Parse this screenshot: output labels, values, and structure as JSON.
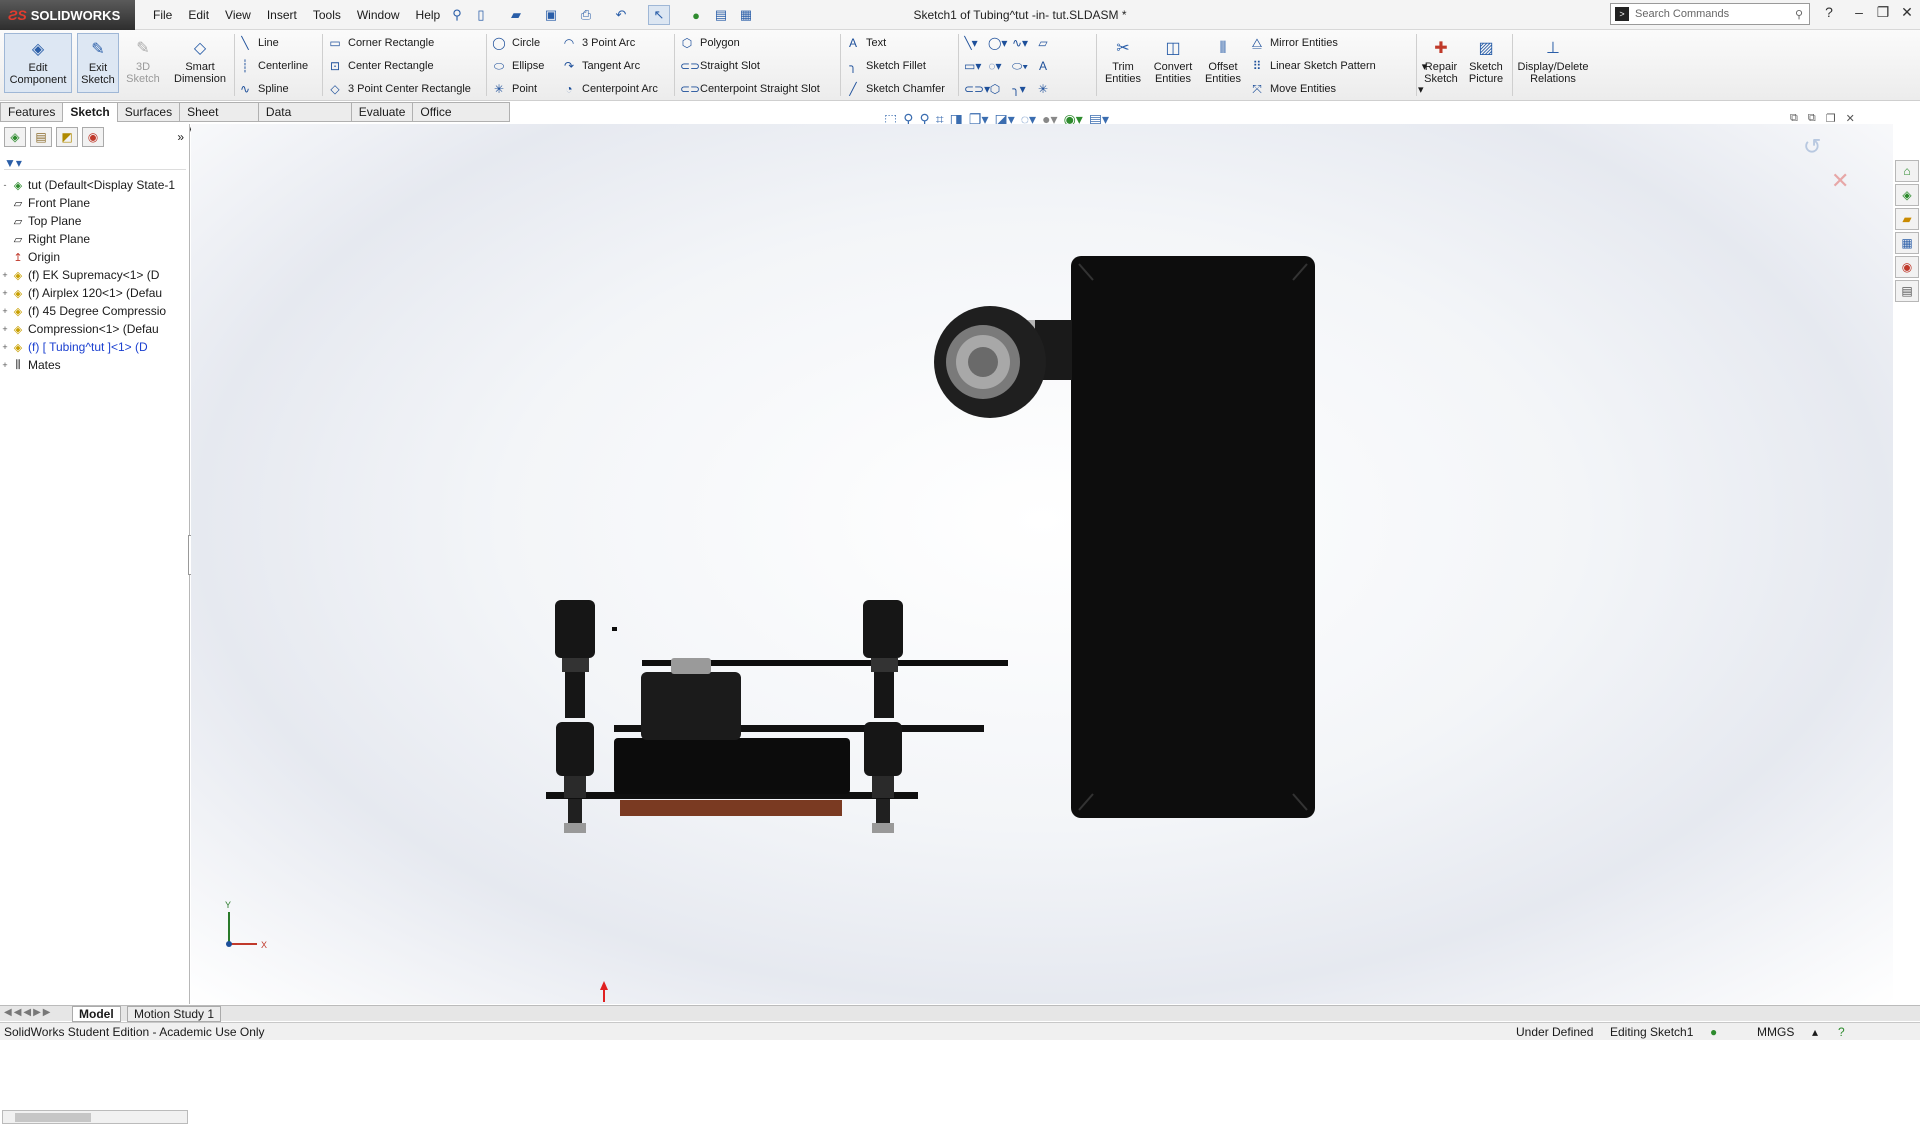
{
  "app": {
    "logo_text": "SOLIDWORKS",
    "document_title": "Sketch1 of Tubing^tut -in- tut.SLDASM *"
  },
  "menu": [
    "File",
    "Edit",
    "View",
    "Insert",
    "Tools",
    "Window",
    "Help"
  ],
  "search": {
    "placeholder": "Search Commands"
  },
  "ribbon": {
    "big_buttons": [
      {
        "label": "Edit Component",
        "icon": "edit-component-icon"
      },
      {
        "label": "Exit Sketch",
        "icon": "exit-sketch-icon"
      },
      {
        "label": "3D Sketch",
        "icon": "3d-sketch-icon"
      },
      {
        "label": "Smart Dimension",
        "icon": "smart-dimension-icon"
      }
    ],
    "col1": [
      "Line",
      "Centerline",
      "Spline"
    ],
    "col2": [
      "Corner Rectangle",
      "Center Rectangle",
      "3 Point Center Rectangle"
    ],
    "col3": [
      "Circle",
      "Ellipse",
      "Point"
    ],
    "col4": [
      "3 Point Arc",
      "Tangent Arc",
      "Centerpoint Arc"
    ],
    "col5": [
      "Polygon",
      "Straight Slot",
      "Centerpoint Straight Slot"
    ],
    "col6": [
      "Text",
      "Sketch Fillet",
      "Sketch Chamfer"
    ],
    "mid_buttons": [
      {
        "label": "Trim Entities",
        "icon": "trim-entities-icon"
      },
      {
        "label": "Convert Entities",
        "icon": "convert-entities-icon"
      },
      {
        "label": "Offset Entities",
        "icon": "offset-entities-icon"
      }
    ],
    "col7": [
      "Mirror Entities",
      "Linear Sketch Pattern",
      "Move Entities"
    ],
    "right_buttons": [
      {
        "label": "Repair Sketch",
        "icon": "repair-sketch-icon"
      },
      {
        "label": "Sketch Picture",
        "icon": "sketch-picture-icon"
      },
      {
        "label": "Display/Delete Relations",
        "icon": "relations-icon"
      }
    ]
  },
  "tabs": [
    "Features",
    "Sketch",
    "Surfaces",
    "Sheet Metal",
    "Data Migration",
    "Evaluate",
    "Office Products"
  ],
  "active_tab": "Sketch",
  "feature_tree": [
    {
      "label": "tut  (Default<Display State-1",
      "icon": "assembly-icon",
      "expander": "-"
    },
    {
      "label": "Front Plane",
      "icon": "plane-icon",
      "expander": ""
    },
    {
      "label": "Top Plane",
      "icon": "plane-icon",
      "expander": ""
    },
    {
      "label": "Right Plane",
      "icon": "plane-icon",
      "expander": ""
    },
    {
      "label": "Origin",
      "icon": "origin-icon",
      "expander": ""
    },
    {
      "label": "(f) EK Supremacy<1> (D",
      "icon": "part-icon",
      "expander": "+"
    },
    {
      "label": "(f) Airplex 120<1> (Defau",
      "icon": "part-icon",
      "expander": "+"
    },
    {
      "label": "(f) 45 Degree Compressio",
      "icon": "part-icon",
      "expander": "+"
    },
    {
      "label": "Compression<1> (Defau",
      "icon": "part-icon",
      "expander": "+"
    },
    {
      "label": "(f) [ Tubing^tut ]<1> (D",
      "icon": "part-icon",
      "expander": "+",
      "highlight": true
    },
    {
      "label": "Mates",
      "icon": "mates-icon",
      "expander": "+"
    }
  ],
  "bottom_tabs": [
    "Model",
    "Motion Study 1"
  ],
  "status": {
    "left": "SolidWorks Student Edition - Academic Use Only",
    "state": "Under Defined",
    "editing": "Editing Sketch1",
    "units": "MMGS"
  },
  "colors": {
    "ribbon_accent": "#2a5ea8",
    "model_black": "#0d0d0d",
    "copper": "#7a3a22"
  }
}
